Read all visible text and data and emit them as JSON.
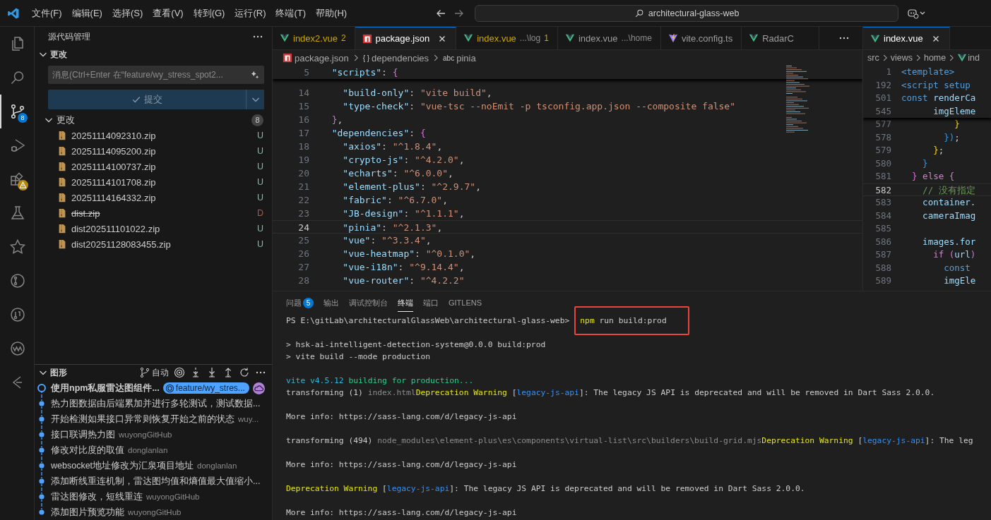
{
  "title_bar": {
    "menus": [
      "文件(F)",
      "编辑(E)",
      "选择(S)",
      "查看(V)",
      "转到(G)",
      "运行(R)",
      "终端(T)",
      "帮助(H)"
    ],
    "search": "architectural-glass-web"
  },
  "activity_bar": [
    {
      "kind": "explorer",
      "selected": false
    },
    {
      "kind": "search",
      "selected": false
    },
    {
      "kind": "source-control",
      "selected": true,
      "badge": {
        "kind": "count",
        "text": "8"
      }
    },
    {
      "kind": "run-debug",
      "selected": false
    },
    {
      "kind": "extensions",
      "selected": false,
      "badge": {
        "kind": "warning"
      }
    },
    {
      "kind": "testing",
      "selected": false
    },
    {
      "kind": "deploy",
      "selected": false
    },
    {
      "kind": "git",
      "selected": false
    },
    {
      "kind": "git-pr",
      "selected": false
    },
    {
      "kind": "wave",
      "selected": false
    },
    {
      "kind": "timeline",
      "selected": false
    }
  ],
  "source_control": {
    "title": "源代码管理",
    "section": "更改",
    "message_input": {
      "placeholder": "消息(Ctrl+Enter 在“feature/wy_stress_spot2..."
    },
    "commit_button": "提交",
    "changes": {
      "title": "更改",
      "count": "8",
      "files": [
        {
          "name": "20251114092310.zip",
          "status": "U",
          "deleted": false
        },
        {
          "name": "20251114095200.zip",
          "status": "U",
          "deleted": false
        },
        {
          "name": "20251114100737.zip",
          "status": "U",
          "deleted": false
        },
        {
          "name": "20251114101708.zip",
          "status": "U",
          "deleted": false
        },
        {
          "name": "20251114164332.zip",
          "status": "U",
          "deleted": false
        },
        {
          "name": "dist.zip",
          "status": "D",
          "deleted": true
        },
        {
          "name": "dist202511101022.zip",
          "status": "U",
          "deleted": false
        },
        {
          "name": "dist20251128083455.zip",
          "status": "U",
          "deleted": false
        }
      ]
    }
  },
  "graph": {
    "title": "图形",
    "auto_label": "自动",
    "commits": [
      {
        "message": "使用npm私服雷达图组件...",
        "current": true,
        "branch": "feature/wy_stres..."
      },
      {
        "message": "热力图数据由后端累加并进行多轮测试，测试数据...",
        "current": false
      },
      {
        "message": "开始检测如果接口异常则恢复开始之前的状态",
        "author": "wuy...",
        "current": false
      },
      {
        "message": "接口联调热力图",
        "author": "wuyongGitHub",
        "current": false
      },
      {
        "message": "修改对比度的取值",
        "author": "donglanlan",
        "current": false
      },
      {
        "message": "websocket地址修改为汇泉项目地址",
        "author": "donglanlan",
        "current": false
      },
      {
        "message": "添加断线重连机制，雷达图均值和熵值最大值缩小...",
        "current": false
      },
      {
        "message": "雷达图修改，短线重连",
        "author": "wuyongGitHub",
        "current": false
      },
      {
        "message": "添加图片预览功能",
        "author": "wuyongGitHub",
        "current": false
      }
    ]
  },
  "editor_groups": [
    {
      "tabs": [
        {
          "kind": "vue",
          "label": "index2.vue",
          "badge": "2",
          "warning": true,
          "selected": false
        },
        {
          "kind": "npm",
          "label": "package.json",
          "warning": false,
          "selected": true
        },
        {
          "kind": "vue",
          "label": "index.vue",
          "description": "...\\log",
          "badge": "1",
          "warning": true,
          "selected": false
        },
        {
          "kind": "vue",
          "label": "index.vue",
          "description": "...\\home",
          "warning": false,
          "selected": false
        },
        {
          "kind": "vite",
          "label": "vite.config.ts",
          "warning": false,
          "selected": false
        },
        {
          "kind": "vue",
          "label": "RadarC",
          "warning": false,
          "selected": false
        }
      ],
      "breadcrumbs": [
        {
          "kind": "npm",
          "label": "package.json"
        },
        {
          "symbol": "{ }",
          "label": "dependencies"
        },
        {
          "symbol": "abc",
          "label": "pinia"
        }
      ],
      "sticky_lines": [
        {
          "num": "5",
          "tokens": [
            {
              "kind": "key",
              "text": "  \"scripts\""
            },
            {
              "kind": "punct",
              "text": ": "
            },
            {
              "kind": "pink",
              "text": "{"
            }
          ]
        }
      ],
      "lines": [
        {
          "num": "14",
          "current": false,
          "tokens": [
            {
              "kind": "key",
              "text": "    \"build-only\""
            },
            {
              "kind": "punct",
              "text": ": "
            },
            {
              "kind": "string",
              "text": "\"vite build\""
            },
            {
              "kind": "punct",
              "text": ","
            }
          ]
        },
        {
          "num": "15",
          "current": false,
          "tokens": [
            {
              "kind": "key",
              "text": "    \"type-check\""
            },
            {
              "kind": "punct",
              "text": ": "
            },
            {
              "kind": "string",
              "text": "\"vue-tsc --noEmit -p tsconfig.app.json --composite false\""
            }
          ]
        },
        {
          "num": "16",
          "current": false,
          "tokens": [
            {
              "kind": "pink",
              "text": "  }"
            },
            {
              "kind": "punct",
              "text": ","
            }
          ]
        },
        {
          "num": "17",
          "current": false,
          "tokens": [
            {
              "kind": "key",
              "text": "  \"dependencies\""
            },
            {
              "kind": "punct",
              "text": ": "
            },
            {
              "kind": "pink",
              "text": "{"
            }
          ]
        },
        {
          "num": "18",
          "current": false,
          "tokens": [
            {
              "kind": "key",
              "text": "    \"axios\""
            },
            {
              "kind": "punct",
              "text": ": "
            },
            {
              "kind": "string",
              "text": "\"^1.8.4\""
            },
            {
              "kind": "punct",
              "text": ","
            }
          ]
        },
        {
          "num": "19",
          "current": false,
          "tokens": [
            {
              "kind": "key",
              "text": "    \"crypto-js\""
            },
            {
              "kind": "punct",
              "text": ": "
            },
            {
              "kind": "string",
              "text": "\"^4.2.0\""
            },
            {
              "kind": "punct",
              "text": ","
            }
          ]
        },
        {
          "num": "20",
          "current": false,
          "tokens": [
            {
              "kind": "key",
              "text": "    \"echarts\""
            },
            {
              "kind": "punct",
              "text": ": "
            },
            {
              "kind": "string",
              "text": "\"^6.0.0\""
            },
            {
              "kind": "punct",
              "text": ","
            }
          ]
        },
        {
          "num": "21",
          "current": false,
          "tokens": [
            {
              "kind": "key",
              "text": "    \"element-plus\""
            },
            {
              "kind": "punct",
              "text": ": "
            },
            {
              "kind": "string",
              "text": "\"^2.9.7\""
            },
            {
              "kind": "punct",
              "text": ","
            }
          ]
        },
        {
          "num": "22",
          "current": false,
          "tokens": [
            {
              "kind": "key",
              "text": "    \"fabric\""
            },
            {
              "kind": "punct",
              "text": ": "
            },
            {
              "kind": "string",
              "text": "\"^6.7.0\""
            },
            {
              "kind": "punct",
              "text": ","
            }
          ]
        },
        {
          "num": "23",
          "current": false,
          "tokens": [
            {
              "kind": "key",
              "text": "    \"JB-design\""
            },
            {
              "kind": "punct",
              "text": ": "
            },
            {
              "kind": "string",
              "text": "\"^1.1.1\""
            },
            {
              "kind": "punct",
              "text": ","
            }
          ]
        },
        {
          "num": "24",
          "current": true,
          "tokens": [
            {
              "kind": "key",
              "text": "    \"pinia\""
            },
            {
              "kind": "punct",
              "text": ": "
            },
            {
              "kind": "string",
              "text": "\"^2.1.3\""
            },
            {
              "kind": "punct",
              "text": ","
            }
          ]
        },
        {
          "num": "25",
          "current": false,
          "tokens": [
            {
              "kind": "key",
              "text": "    \"vue\""
            },
            {
              "kind": "punct",
              "text": ": "
            },
            {
              "kind": "string",
              "text": "\"^3.3.4\""
            },
            {
              "kind": "punct",
              "text": ","
            }
          ]
        },
        {
          "num": "26",
          "current": false,
          "tokens": [
            {
              "kind": "key",
              "text": "    \"vue-heatmap\""
            },
            {
              "kind": "punct",
              "text": ": "
            },
            {
              "kind": "string",
              "text": "\"^0.1.0\""
            },
            {
              "kind": "punct",
              "text": ","
            }
          ]
        },
        {
          "num": "27",
          "current": false,
          "tokens": [
            {
              "kind": "key",
              "text": "    \"vue-i18n\""
            },
            {
              "kind": "punct",
              "text": ": "
            },
            {
              "kind": "string",
              "text": "\"^9.14.4\""
            },
            {
              "kind": "punct",
              "text": ","
            }
          ]
        },
        {
          "num": "28",
          "current": false,
          "tokens": [
            {
              "kind": "key",
              "text": "    \"vue-router\""
            },
            {
              "kind": "punct",
              "text": ": "
            },
            {
              "kind": "string",
              "text": "\"^4.2.2\""
            }
          ]
        }
      ]
    },
    {
      "tabs": [
        {
          "kind": "vue",
          "label": "index.vue",
          "warning": false,
          "selected": true
        }
      ],
      "breadcrumbs": [
        {
          "label": "src"
        },
        {
          "label": "views"
        },
        {
          "label": "home"
        },
        {
          "kind": "vue",
          "label": "ind"
        }
      ],
      "sticky_lines": [
        {
          "num": "1",
          "tokens": [
            {
              "kind": "tag",
              "text": "<template>"
            }
          ]
        },
        {
          "num": "192",
          "tokens": [
            {
              "kind": "tag",
              "text": "<script setup"
            }
          ]
        },
        {
          "num": "501",
          "tokens": [
            {
              "kind": "keyword",
              "text": "const"
            },
            {
              "kind": "variable",
              "text": " renderCa"
            }
          ]
        },
        {
          "num": "545",
          "tokens": [
            {
              "kind": "variable",
              "text": "      imgEleme"
            }
          ]
        }
      ],
      "lines": [
        {
          "num": "577",
          "current": false,
          "tokens": [
            {
              "kind": "yellow",
              "text": "          }"
            }
          ]
        },
        {
          "num": "578",
          "current": false,
          "tokens": [
            {
              "kind": "blue",
              "text": "        })"
            },
            {
              "kind": "punct",
              "text": ";"
            }
          ]
        },
        {
          "num": "579",
          "current": false,
          "tokens": [
            {
              "kind": "yellow",
              "text": "      }"
            },
            {
              "kind": "punct",
              "text": ";"
            }
          ]
        },
        {
          "num": "580",
          "current": false,
          "tokens": [
            {
              "kind": "blue",
              "text": "    }"
            }
          ]
        },
        {
          "num": "581",
          "current": false,
          "tokens": [
            {
              "kind": "pink",
              "text": "  }"
            },
            {
              "kind": "control",
              "text": " else"
            },
            {
              "kind": "pink",
              "text": " {"
            }
          ]
        },
        {
          "num": "582",
          "current": true,
          "tokens": [
            {
              "kind": "comment",
              "text": "    // 没有指定"
            }
          ]
        },
        {
          "num": "583",
          "current": false,
          "tokens": [
            {
              "kind": "variable",
              "text": "    container."
            }
          ]
        },
        {
          "num": "584",
          "current": false,
          "tokens": [
            {
              "kind": "variable",
              "text": "    cameraImag"
            }
          ]
        },
        {
          "num": "585",
          "current": false
        },
        {
          "num": "586",
          "current": false,
          "tokens": [
            {
              "kind": "variable",
              "text": "    images.for"
            }
          ]
        },
        {
          "num": "587",
          "current": false,
          "tokens": [
            {
              "kind": "control",
              "text": "      if"
            },
            {
              "kind": "pink",
              "text": " ("
            },
            {
              "kind": "variable",
              "text": "url"
            },
            {
              "kind": "pink",
              "text": ")"
            }
          ]
        },
        {
          "num": "588",
          "current": false,
          "tokens": [
            {
              "kind": "keyword",
              "text": "        const"
            }
          ]
        },
        {
          "num": "589",
          "current": false,
          "tokens": [
            {
              "kind": "variable",
              "text": "        imgEle"
            }
          ]
        }
      ]
    }
  ],
  "panel": {
    "tabs": [
      {
        "label": "问题",
        "badge": "5",
        "selected": false
      },
      {
        "label": "输出",
        "selected": false
      },
      {
        "label": "调试控制台",
        "selected": false
      },
      {
        "label": "终端",
        "selected": true
      },
      {
        "label": "端口",
        "selected": false
      },
      {
        "label": "GITLENS",
        "selected": false
      }
    ],
    "terminal": [
      {
        "kind": "prompt",
        "prompt": "PS E:\\gitLab\\architecturalGlassWeb\\architectural-glass-web>",
        "command": "npm",
        "args": "run build:prod",
        "highlighted": true
      },
      {
        "kind": "blank"
      },
      {
        "kind": "output",
        "segments": [
          {
            "kind": "plain",
            "text": "> hsk-ai-intelligent-detection-system@0.0.0 build:prod"
          }
        ]
      },
      {
        "kind": "output",
        "segments": [
          {
            "kind": "plain",
            "text": "> vite build --mode production"
          }
        ]
      },
      {
        "kind": "blank"
      },
      {
        "kind": "output",
        "segments": [
          {
            "kind": "cyan",
            "text": "vite v4.5.12 "
          },
          {
            "kind": "green",
            "text": "building for production..."
          }
        ]
      },
      {
        "kind": "output",
        "segments": [
          {
            "kind": "plain",
            "text": "transforming (1) "
          },
          {
            "kind": "dim",
            "text": "index.html"
          },
          {
            "kind": "yellow",
            "text": "Deprecation Warning"
          },
          {
            "kind": "plain",
            "text": " ["
          },
          {
            "kind": "blue",
            "text": "legacy-js-api"
          },
          {
            "kind": "plain",
            "text": "]: The legacy JS API is deprecated and will be removed in Dart Sass 2.0.0."
          }
        ]
      },
      {
        "kind": "blank"
      },
      {
        "kind": "output",
        "segments": [
          {
            "kind": "plain",
            "text": "More info: https://sass-lang.com/d/legacy-js-api"
          }
        ]
      },
      {
        "kind": "blank"
      },
      {
        "kind": "output",
        "segments": [
          {
            "kind": "plain",
            "text": "transforming (494) "
          },
          {
            "kind": "dim",
            "text": "node_modules\\element-plus\\es\\components\\virtual-list\\src\\builders\\build-grid.mjs"
          },
          {
            "kind": "yellow",
            "text": "Deprecation Warning"
          },
          {
            "kind": "plain",
            "text": " ["
          },
          {
            "kind": "blue",
            "text": "legacy-js-api"
          },
          {
            "kind": "plain",
            "text": "]: The leg"
          }
        ]
      },
      {
        "kind": "blank"
      },
      {
        "kind": "output",
        "segments": [
          {
            "kind": "plain",
            "text": "More info: https://sass-lang.com/d/legacy-js-api"
          }
        ]
      },
      {
        "kind": "blank"
      },
      {
        "kind": "output",
        "segments": [
          {
            "kind": "yellow",
            "text": "Deprecation Warning"
          },
          {
            "kind": "plain",
            "text": " ["
          },
          {
            "kind": "blue",
            "text": "legacy-js-api"
          },
          {
            "kind": "plain",
            "text": "]: The legacy JS API is deprecated and will be removed in Dart Sass 2.0.0."
          }
        ]
      },
      {
        "kind": "blank"
      },
      {
        "kind": "output",
        "segments": [
          {
            "kind": "plain",
            "text": "More info: https://sass-lang.com/d/legacy-js-api"
          }
        ]
      }
    ]
  }
}
